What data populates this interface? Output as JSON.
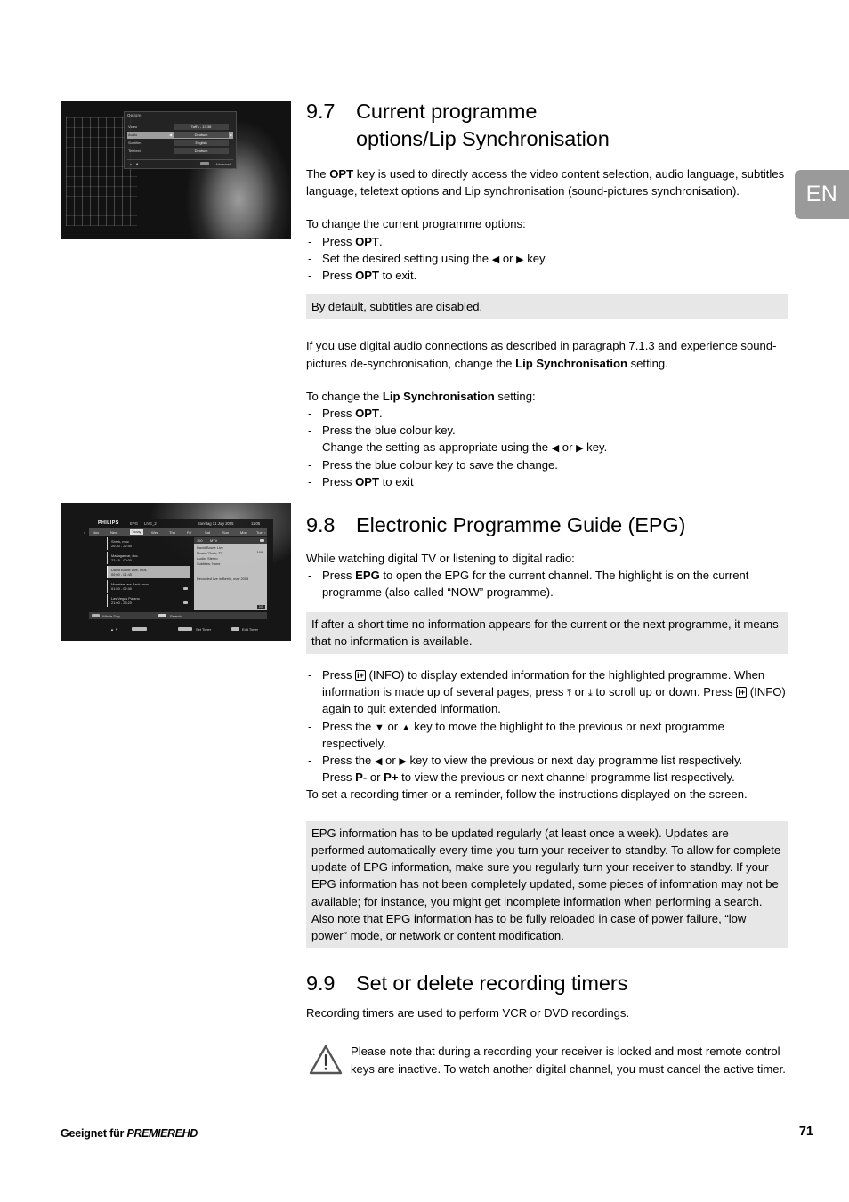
{
  "language_tab": "EN",
  "sections": {
    "s97": {
      "number": "9.7",
      "title_line1": "Current programme",
      "title_line2": "options/Lip Synchronisation",
      "intro_a": "The ",
      "intro_opt": "OPT",
      "intro_b": " key is used to directly access the video content selection, audio language, subtitles language, teletext options and Lip synchronisation (sound-pictures synchronisation).",
      "lead_options": "To change the current programme options:",
      "step1_a": "Press ",
      "step1_key": "OPT",
      "step1_b": ".",
      "step2_a": "Set the desired setting using the ",
      "step2_b": " or ",
      "step2_c": " key.",
      "step3_a": "Press ",
      "step3_key": "OPT",
      "step3_b": " to exit.",
      "note_subtitles": "By default, subtitles are disabled.",
      "para_sync_a": "If you use digital audio connections as described in paragraph 7.1.3 and experience sound-pictures de-synchronisation, change the ",
      "para_sync_bold": "Lip Synchronisation",
      "para_sync_b": " setting.",
      "lead_sync_a": "To change the ",
      "lead_sync_bold": "Lip Synchronisation",
      "lead_sync_b": " setting:",
      "sync1_a": "Press ",
      "sync1_key": "OPT",
      "sync1_b": ".",
      "sync2": "Press the blue colour key.",
      "sync3_a": "Change the setting as appropriate using the ",
      "sync3_b": " or ",
      "sync3_c": " key.",
      "sync4": "Press the blue colour key to save the change.",
      "sync5_a": "Press ",
      "sync5_key": "OPT",
      "sync5_b": " to exit"
    },
    "s98": {
      "number": "9.8",
      "title": "Electronic Programme Guide (EPG)",
      "lead": "While watching digital TV or listening to digital radio:",
      "b1_a": "Press ",
      "b1_key": "EPG",
      "b1_b": " to open the EPG for the current channel. The highlight is on the current programme (also called “NOW” programme).",
      "note_noinfo": "If after a short time no information appears for the current or the next programme, it means that no information is available.",
      "b2_a": "Press ",
      "b2_info": "i+",
      "b2_b": " (INFO) to display extended information for the highlighted programme. When information is made up of several pages, press ",
      "b2_c": " or ",
      "b2_d": " to scroll up or down. Press ",
      "b2_e": " (INFO) again to quit extended information.",
      "b3_a": "Press the ",
      "b3_b": " or ",
      "b3_c": " key to move the highlight to the previous or next programme respectively.",
      "b4_a": "Press the ",
      "b4_b": " or ",
      "b4_c": " key to view the previous or next day programme list respectively.",
      "b5_a": "Press ",
      "b5_pm": "P-",
      "b5_b": " or ",
      "b5_pp": "P+",
      "b5_c": " to view the previous or next channel programme list respectively.",
      "b6": "To set a recording timer or a reminder, follow the instructions displayed on the screen.",
      "note_epg_update": "EPG information has to be updated regularly (at least once a week). Updates are performed automatically every time you turn your receiver to standby. To allow for complete update of EPG information, make sure you regularly turn your receiver to standby. If your EPG information has not been completely updated, some pieces of information may not be available; for instance, you might get incomplete information when performing a search. Also note that EPG information has to be fully reloaded in case of power failure, “low power” mode, or network or content modification."
    },
    "s99": {
      "number": "9.9",
      "title": "Set or delete recording timers",
      "lead": "Recording timers are used to perform VCR or DVD recordings.",
      "warning": "Please note that during a recording your receiver is locked and most remote control keys are inactive. To watch another digital channel, you must cancel the active timer."
    }
  },
  "screenshot_options": {
    "title": "Options",
    "rows": [
      {
        "label": "Video",
        "value": "Taff's - 13:38"
      },
      {
        "label": "Audio",
        "value": "Deutsch"
      },
      {
        "label": "Subtitles",
        "value": "English"
      },
      {
        "label": "Teletext",
        "value": "Deutsch"
      }
    ],
    "nav_hint": "▲ ▼",
    "advanced": "Advanced",
    "arrow_left": "◀",
    "arrow_right": "▶"
  },
  "screenshot_epg": {
    "brand": "PHILIPS",
    "label_epg": "EPG",
    "channel": "LIVE_2",
    "date": "Sonntag  31 July 2005",
    "time": "11:05",
    "days": [
      "Nov",
      "Next",
      "Today",
      "Wed",
      "Thu",
      "Fri",
      "Sat",
      "Sun",
      "Mon",
      "Tue"
    ],
    "day_selected": "Today",
    "programmes": [
      {
        "title": "Shrek, mov.",
        "time": "20:30 - 22:40"
      },
      {
        "title": "Madagascar, doc.",
        "time": "22:45 - 00:00"
      },
      {
        "title": "David Bowie Live, mus.",
        "time": "00:00 - 01:45"
      },
      {
        "title": "Monsters are Back, mov.",
        "time": "01:50 - 02:40"
      },
      {
        "title": "Las Vegas Parano",
        "time": "21:00 - 23:20"
      }
    ],
    "selected_index": 2,
    "detail": {
      "number": "100",
      "name": "MTV",
      "lines": [
        "David Bowie Live",
        "Music / Rock, TT",
        "Audio: Stereo",
        "Subtitles: None"
      ],
      "ratio": "16/9",
      "description": "Recorded live in Berlin, may 2003",
      "page": "1/1"
    },
    "bar": [
      {
        "key": "red",
        "label": "Whole Day"
      },
      {
        "key": "gray",
        "label": "Search"
      }
    ],
    "footer": [
      {
        "key": "nav",
        "label": "▲ ▼"
      },
      {
        "key": "pm",
        "label": "P+ P-"
      },
      {
        "key": "color",
        "label": "Set Timer"
      },
      {
        "key": "ok",
        "label": "Edit Timer"
      }
    ]
  },
  "footer": {
    "suitable_for": "Geeignet für",
    "brand": "PREMIEREHD",
    "page_number": "71"
  }
}
